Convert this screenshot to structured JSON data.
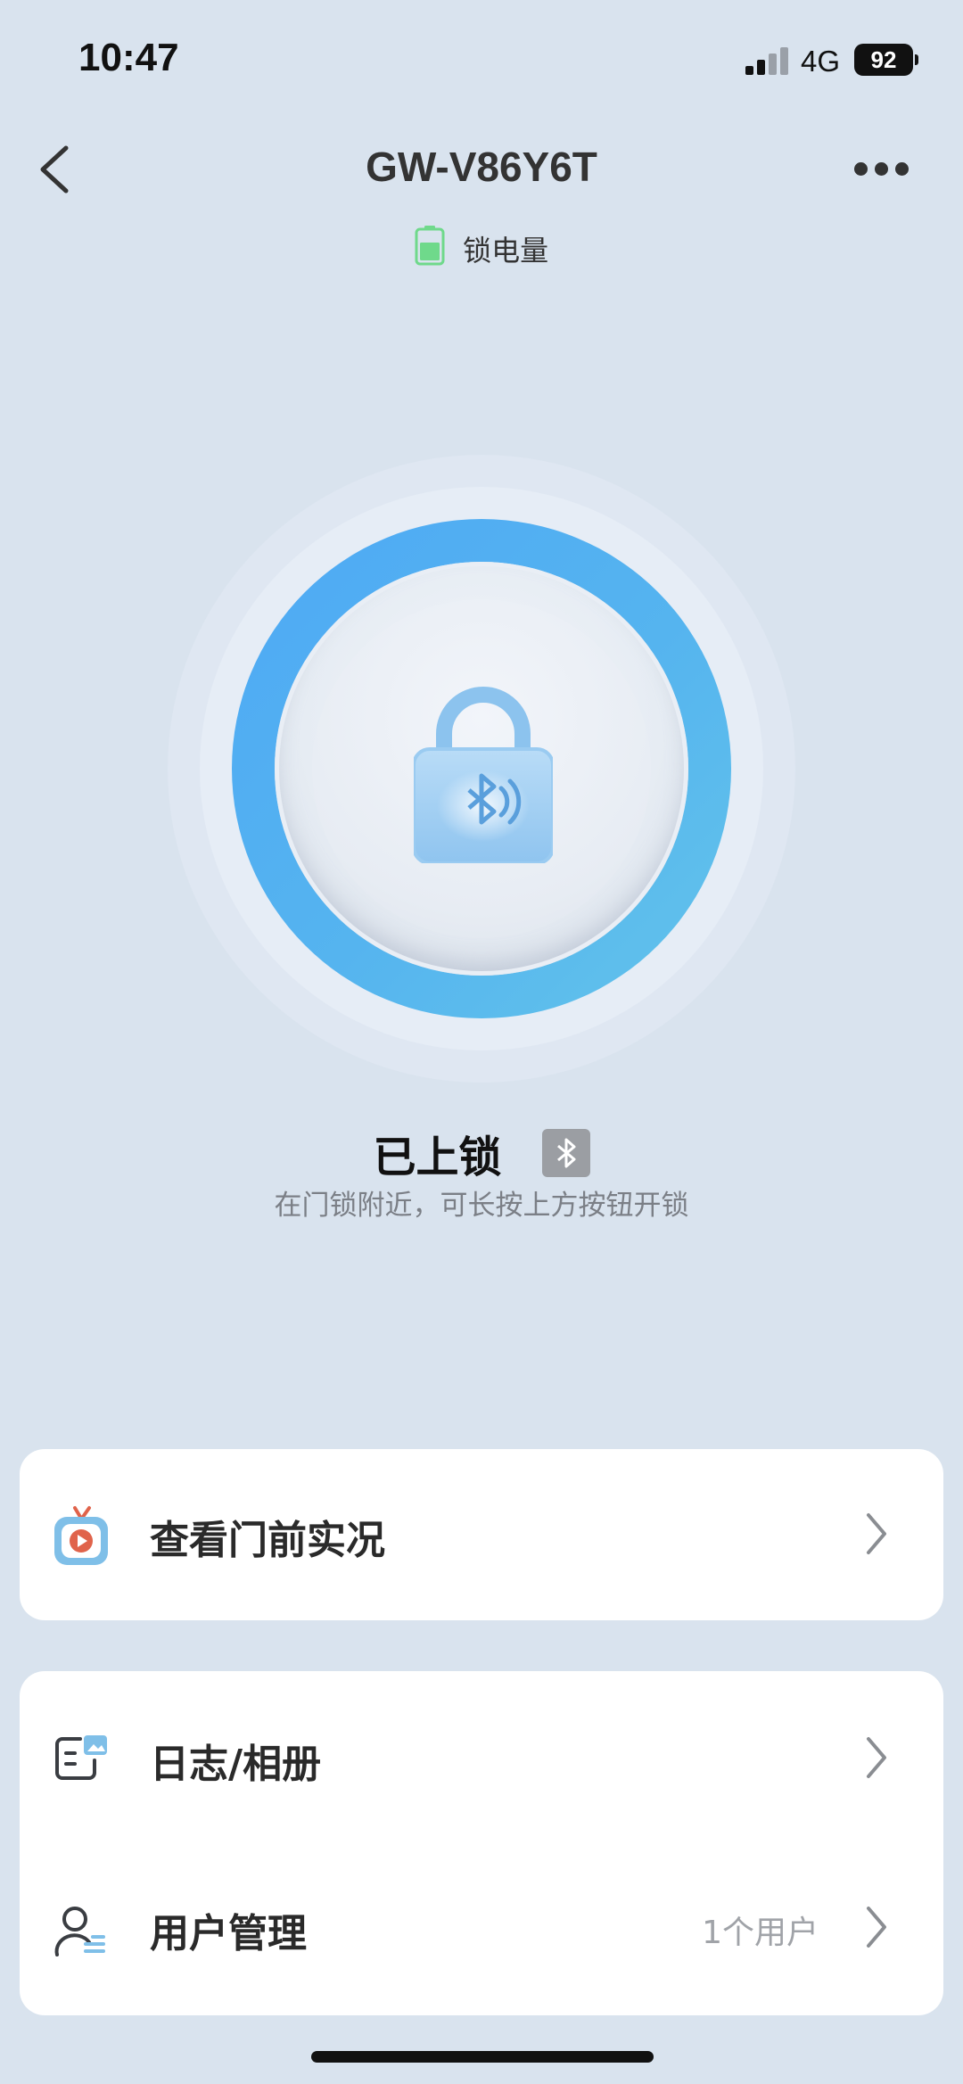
{
  "status_bar": {
    "time": "10:47",
    "network": "4G",
    "battery": "92"
  },
  "header": {
    "title": "GW-V86Y6T",
    "back_icon": "chevron-left-icon",
    "more_icon": "more-dots-icon"
  },
  "battery_indicator": {
    "label": "锁电量",
    "icon": "battery-icon",
    "color": "#5fd37f"
  },
  "lock": {
    "icon": "bluetooth-padlock-icon",
    "ring_color": "#4ea9f5",
    "status": "已上锁",
    "hint": "在门锁附近，可长按上方按钮开锁",
    "badge_icon": "bluetooth-icon"
  },
  "menu": {
    "live_view": {
      "label": "查看门前实况",
      "icon": "tv-play-icon"
    },
    "logs": {
      "label": "日志/相册",
      "icon": "log-album-icon"
    },
    "users": {
      "label": "用户管理",
      "value": "1个用户",
      "icon": "user-manage-icon"
    }
  }
}
